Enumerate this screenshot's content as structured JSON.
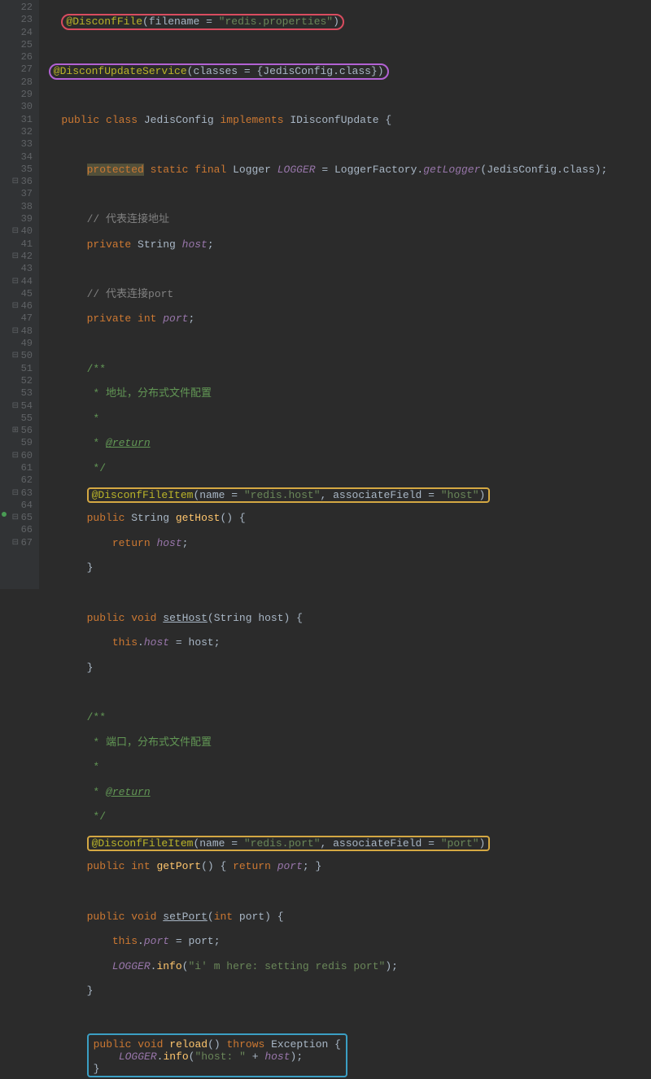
{
  "lines": [
    {
      "n": "22",
      "fold": "",
      "code": "   "
    },
    {
      "n": "23",
      "fold": "",
      "code": "   "
    },
    {
      "n": "24",
      "fold": "",
      "code": " "
    },
    {
      "n": "25",
      "fold": "",
      "code": ""
    },
    {
      "n": "26",
      "fold": "",
      "code": "   "
    },
    {
      "n": "27",
      "fold": "",
      "code": ""
    },
    {
      "n": "28",
      "fold": "",
      "code": "       "
    },
    {
      "n": "29",
      "fold": "",
      "code": ""
    },
    {
      "n": "30",
      "fold": "",
      "code": "       "
    },
    {
      "n": "31",
      "fold": "",
      "code": "       "
    },
    {
      "n": "32",
      "fold": "",
      "code": ""
    },
    {
      "n": "33",
      "fold": "",
      "code": "       "
    },
    {
      "n": "34",
      "fold": "",
      "code": "       "
    },
    {
      "n": "35",
      "fold": "",
      "code": ""
    },
    {
      "n": "36",
      "fold": "⊟",
      "code": "       "
    },
    {
      "n": "37",
      "fold": "",
      "code": "        "
    },
    {
      "n": "38",
      "fold": "",
      "code": "        "
    },
    {
      "n": "39",
      "fold": "",
      "code": "        "
    },
    {
      "n": "40",
      "fold": "⊟",
      "code": "        "
    },
    {
      "n": "41",
      "fold": "",
      "code": "       "
    },
    {
      "n": "42",
      "fold": "⊟",
      "code": "       "
    },
    {
      "n": "43",
      "fold": "",
      "code": "           "
    },
    {
      "n": "44",
      "fold": "⊟",
      "code": "       "
    },
    {
      "n": "45",
      "fold": "",
      "code": ""
    },
    {
      "n": "46",
      "fold": "⊟",
      "code": "       "
    },
    {
      "n": "47",
      "fold": "",
      "code": "           "
    },
    {
      "n": "48",
      "fold": "⊟",
      "code": "       "
    },
    {
      "n": "49",
      "fold": "",
      "code": ""
    },
    {
      "n": "50",
      "fold": "⊟",
      "code": "       "
    },
    {
      "n": "51",
      "fold": "",
      "code": "        "
    },
    {
      "n": "52",
      "fold": "",
      "code": "        "
    },
    {
      "n": "53",
      "fold": "",
      "code": "        "
    },
    {
      "n": "54",
      "fold": "⊟",
      "code": "        "
    },
    {
      "n": "55",
      "fold": "",
      "code": "       "
    },
    {
      "n": "56",
      "fold": "⊞",
      "code": "       "
    },
    {
      "n": "59",
      "fold": "",
      "code": ""
    },
    {
      "n": "60",
      "fold": "⊟",
      "code": "       "
    },
    {
      "n": "61",
      "fold": "",
      "code": "           "
    },
    {
      "n": "62",
      "fold": "",
      "code": "           "
    },
    {
      "n": "63",
      "fold": "⊟",
      "code": "       "
    },
    {
      "n": "64",
      "fold": "",
      "code": ""
    },
    {
      "n": "65",
      "fold": "⊟",
      "code": "       "
    },
    {
      "n": "66",
      "fold": "",
      "code": "           "
    },
    {
      "n": "67",
      "fold": "⊟",
      "code": "       "
    }
  ],
  "t": {
    "disconfFile": "@DisconfFile",
    "filename": "filename",
    "eq": " = ",
    "redisProps": "\"redis.properties\"",
    "disconfUpdate": "@DisconfUpdateService",
    "classes": "classes",
    "jedisConfig": "JedisConfig",
    "klass": ".class",
    "public": "public",
    "classKw": "class",
    "implements": "implements",
    "iDisconfUpdate": "IDisconfUpdate",
    "protected": "protected",
    "static": "static",
    "final": "final",
    "logger": "Logger",
    "LOGGER": "LOGGER",
    "loggerFactory": "LoggerFactory",
    "getLogger": "getLogger",
    "comAddr": "// 代表连接地址",
    "private": "private",
    "string": "String",
    "host": "host",
    "comPort": "// 代表连接port",
    "int": "int",
    "port": "port",
    "docStart": "/**",
    "docAddr": " * 地址，分布式文件配置",
    "docStar": " *",
    "docReturn": "@return",
    "docEnd": " */",
    "disconfFileItem": "@DisconfFileItem",
    "name": "name",
    "redisHost": "\"redis.host\"",
    "assocField": "associateField",
    "hostStr": "\"host\"",
    "getHost": "getHost",
    "return": "return",
    "void": "void",
    "setHost": "setHost",
    "this": "this",
    "docPort": " * 端口，分布式文件配置",
    "redisPort": "\"redis.port\"",
    "portStr": "\"port\"",
    "getPort": "getPort",
    "returnPort": "{ return port; }",
    "setPort": "setPort",
    "info": "info",
    "infoStr": "\"i' m here: setting redis port\"",
    "reload": "reload",
    "throws": "throws",
    "exception": "Exception",
    "hostConcat": "\"host: \"",
    "plus": " + "
  }
}
